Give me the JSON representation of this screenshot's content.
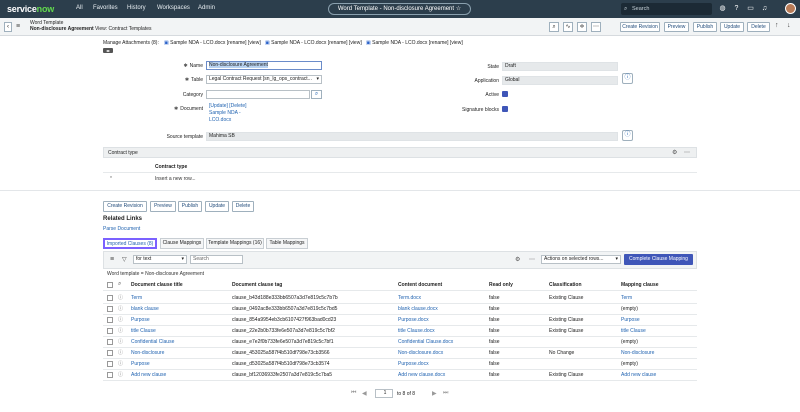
{
  "topnav": {
    "brand": "servicenow",
    "menu": [
      "All",
      "Favorites",
      "History",
      "Workspaces",
      "Admin"
    ],
    "record_title": "Word Template - Non-disclosure Agreement",
    "search_placeholder": "Search"
  },
  "header": {
    "record_type": "Word Template",
    "record_name": "Non-disclosure Agreement",
    "view": "View: Contract Templates",
    "buttons": [
      "Create Revision",
      "Preview",
      "Publish",
      "Update",
      "Delete"
    ]
  },
  "attachments": {
    "label": "Manage Attachments (8):",
    "files": [
      "Sample NDA - LCO.docx [rename] [view]",
      "Sample NDA - LCO.docx [rename] [view]",
      "Sample NDA - LCO.docx [rename] [view]"
    ]
  },
  "form": {
    "name": {
      "label": "Name",
      "value": "Non-disclosure Agreement"
    },
    "table": {
      "label": "Table",
      "value": "Legal Contract Request [sn_lg_ops_contract..."
    },
    "category": {
      "label": "Category",
      "value": ""
    },
    "document": {
      "label": "Document",
      "links": "[Update] [Delete]",
      "file": "Sample NDA -",
      "file2": "LCO.docx"
    },
    "state": {
      "label": "State",
      "value": "Draft"
    },
    "application": {
      "label": "Application",
      "value": "Global"
    },
    "active": {
      "label": "Active",
      "checked": true
    },
    "signature": {
      "label": "Signature blocks",
      "checked": true
    },
    "source": {
      "label": "Source template",
      "value": "Mahima SB"
    }
  },
  "contract_type": {
    "title": "Contract type",
    "column": "Contract type",
    "insert": "Insert a new row..."
  },
  "bottom_buttons": [
    "Create Revision",
    "Preview",
    "Publish",
    "Update",
    "Delete"
  ],
  "related": {
    "title": "Related Links",
    "parse": "Parse Document"
  },
  "tabs": [
    "Imported Clauses (8)",
    "Clause Mappings",
    "Template Mappings (16)",
    "Table Mappings"
  ],
  "list": {
    "filter_field": "for text",
    "search": "Search",
    "actions": "Actions on selected rows...",
    "complete": "Complete Clause Mapping",
    "breadcrumb": "Word template = Non-disclosure Agreement",
    "columns": [
      "Document clause title",
      "Document clause tag",
      "Content document",
      "Read only",
      "Classification",
      "Mapping clause"
    ],
    "rows": [
      [
        "Term",
        "clause_b43d188e333bb6507a3d7e819c5c7b7b",
        "Term.docx",
        "false",
        "Existing Clause",
        "Term"
      ],
      [
        "blank clause",
        "clause_0492ac8e333bb6507a3d7e819c5c7bd5",
        "blank clause.docx",
        "false",
        "",
        "(empty)"
      ],
      [
        "Purpose",
        "clause_854a9954eb3cb6107427f963bad0cd23",
        "Purpose.docx",
        "false",
        "Existing Clause",
        "Purpose"
      ],
      [
        "title Clause",
        "clause_22e2b0b733fe6e507a3d7e819c5c7bf2",
        "title Clause.docx",
        "false",
        "Existing Clause",
        "title Clause"
      ],
      [
        "Confidential Clause",
        "clause_e7e2f0b733fe6e507a3d7e819c5c7bf1",
        "Confidential Clause.docx",
        "false",
        "",
        "(empty)"
      ],
      [
        "Non-disclosure",
        "clause_453025a587f4b510df798e73cb3566",
        "Non-disclosure.docx",
        "false",
        "No Change",
        "Non-disclosure"
      ],
      [
        "Purpose",
        "clause_d53025a587f4b510df798e73cb3574",
        "Purpose.docx",
        "false",
        "",
        "(empty)"
      ],
      [
        "Add new clause",
        "clause_bf12036933fe2507a3d7e819c5c7ba5",
        "Add new clause.docx",
        "false",
        "Existing Clause",
        "Add new clause"
      ]
    ],
    "pager": "to 8 of 8",
    "page": "1"
  },
  "colors": {
    "nav": "#2c3e4c",
    "accent": "#3f56b8",
    "link": "#1f62b0",
    "tab_highlight": "#7b61ff"
  }
}
